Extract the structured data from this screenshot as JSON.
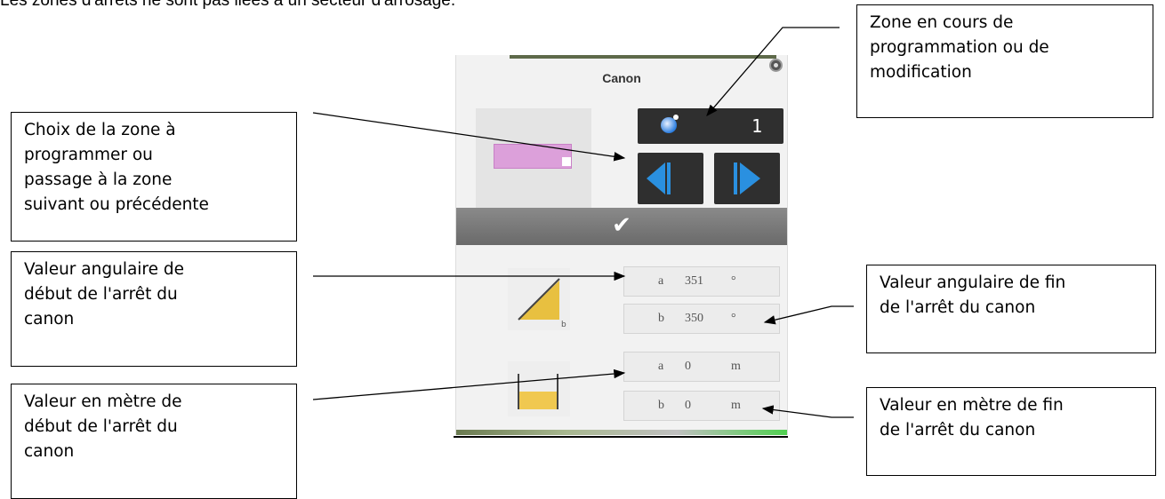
{
  "intro_text": "Les zones d'arrêts ne sont pas liées à un secteur d'arrosage.",
  "callouts": {
    "zone_choice": [
      "Choix de la zone à",
      "programmer ou",
      "passage à la zone",
      "suivant ou précédente"
    ],
    "start_angle": [
      "Valeur angulaire de",
      "début de l'arrêt du",
      "canon"
    ],
    "start_meter": [
      "Valeur en mètre de",
      "début de l'arrêt du",
      "canon"
    ],
    "current_zone": [
      "Zone en cours de",
      "programmation ou de",
      "modification"
    ],
    "end_angle": [
      "Valeur angulaire de fin",
      "de l'arrêt du canon"
    ],
    "end_meter": [
      "Valeur en mètre  de fin",
      "de l'arrêt du canon"
    ]
  },
  "dialog": {
    "title": "Canon",
    "zone_number": "1",
    "angle_start": {
      "label": "a",
      "value": "351",
      "unit": "°"
    },
    "angle_end": {
      "label": "b",
      "value": "350",
      "unit": "°"
    },
    "meter_start": {
      "label": "a",
      "value": "0",
      "unit": "m"
    },
    "meter_end": {
      "label": "b",
      "value": "0",
      "unit": "m"
    },
    "icons": [
      "close-icon",
      "zone-icon",
      "prev-arrow-icon",
      "next-arrow-icon",
      "check-icon",
      "angle-icon",
      "distance-icon"
    ]
  },
  "colors": {
    "accent_blue": "#2a90e0",
    "dark_button": "#2f2f2f",
    "zone_pink": "#dca0da",
    "ok_bar": "#777777"
  }
}
